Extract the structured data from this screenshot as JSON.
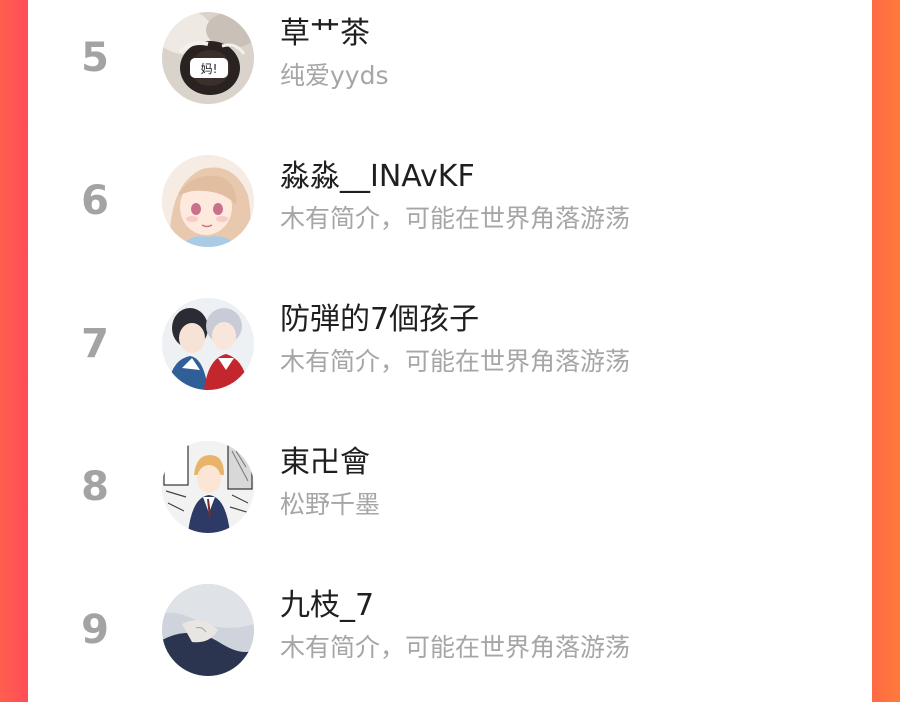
{
  "ranking": {
    "items": [
      {
        "rank": "5",
        "name": "草艹茶",
        "bio": "纯爱yyds",
        "avatar_icon": "dark-cat-avatar-icon",
        "avatar_text": "妈!"
      },
      {
        "rank": "6",
        "name": "淼淼__INAvKF",
        "bio": "木有简介，可能在世界角落游荡",
        "avatar_icon": "anime-girl-avatar-icon"
      },
      {
        "rank": "7",
        "name": "防弾的7個孩子",
        "bio": "木有简介，可能在世界角落游荡",
        "avatar_icon": "anime-boys-avatar-icon"
      },
      {
        "rank": "8",
        "name": "東卍會",
        "bio": "松野千墨",
        "avatar_icon": "manga-avatar-icon"
      },
      {
        "rank": "9",
        "name": "九枝_7",
        "bio": "木有简介，可能在世界角落游荡",
        "avatar_icon": "photo-avatar-icon"
      }
    ]
  }
}
